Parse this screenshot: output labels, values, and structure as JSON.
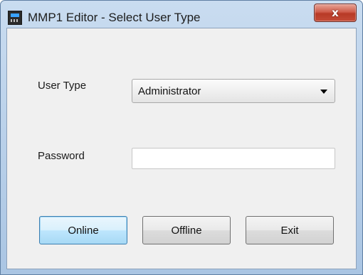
{
  "window": {
    "title": "MMP1 Editor - Select User Type",
    "close_symbol": "x"
  },
  "form": {
    "user_type_label": "User Type",
    "user_type_value": "Administrator",
    "password_label": "Password",
    "password_value": ""
  },
  "buttons": {
    "online": "Online",
    "offline": "Offline",
    "exit": "Exit"
  },
  "icons": {
    "app": "mixer-app-icon",
    "close": "close-icon",
    "dropdown": "chevron-down-icon"
  },
  "colors": {
    "close_button": "#c44a36",
    "default_button_border": "#3c7fb1"
  }
}
